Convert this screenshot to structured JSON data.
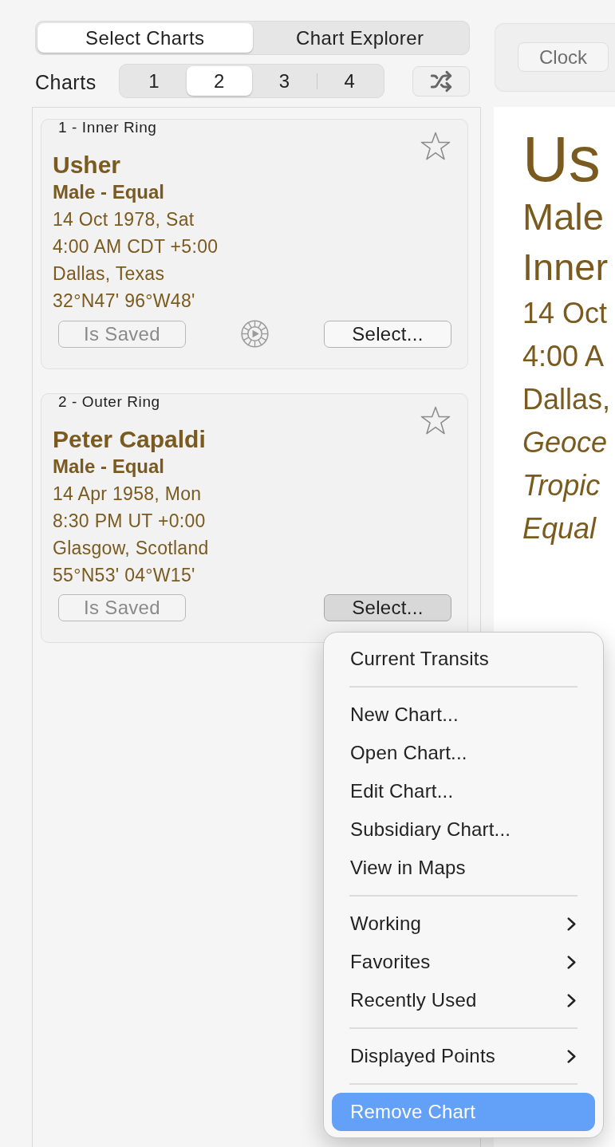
{
  "mode_tabs": [
    {
      "label": "Select Charts",
      "selected": true
    },
    {
      "label": "Chart Explorer",
      "selected": false
    }
  ],
  "charts_selector": {
    "label": "Charts",
    "options": [
      {
        "label": "1",
        "selected": false
      },
      {
        "label": "2",
        "selected": true
      },
      {
        "label": "3",
        "selected": false
      },
      {
        "label": "4",
        "selected": false
      }
    ]
  },
  "clock_panel": {
    "button": {
      "label": "Clock",
      "disabled": true
    }
  },
  "chart_cards": [
    {
      "ring_label": "1 - Inner Ring",
      "name": "Usher",
      "subtitle": "Male - Equal",
      "details": [
        "14 Oct 1978, Sat",
        "4:00 AM CDT +5:00",
        "Dallas, Texas",
        "32°N47' 96°W48'"
      ],
      "favorite": false,
      "saved_button": {
        "label": "Is Saved",
        "disabled": true
      },
      "animate_button": true,
      "select_button": {
        "label": "Select...",
        "pressed": false
      }
    },
    {
      "ring_label": "2 - Outer Ring",
      "name": "Peter Capaldi",
      "subtitle": "Male - Equal",
      "details": [
        "14 Apr 1958, Mon",
        "8:30 PM UT +0:00",
        "Glasgow, Scotland",
        "55°N53' 04°W15'"
      ],
      "favorite": false,
      "saved_button": {
        "label": "Is Saved",
        "disabled": true
      },
      "animate_button": false,
      "select_button": {
        "label": "Select...",
        "pressed": true
      }
    }
  ],
  "chart_details": {
    "lines": [
      {
        "text": "Us",
        "kind": "name"
      },
      {
        "text": "Male",
        "kind": "heading"
      },
      {
        "text": "Inner",
        "kind": "heading"
      },
      {
        "text": "14 Oct",
        "kind": "detail"
      },
      {
        "text": "4:00 A",
        "kind": "detail"
      },
      {
        "text": "Dallas,",
        "kind": "detail"
      },
      {
        "text": "Geoce",
        "kind": "italic"
      },
      {
        "text": "Tropic",
        "kind": "italic"
      },
      {
        "text": "Equal",
        "kind": "italic"
      }
    ]
  },
  "context_menu": {
    "sections": [
      {
        "items": [
          {
            "label": "Current Transits",
            "submenu": false,
            "selected": false
          }
        ]
      },
      {
        "items": [
          {
            "label": "New Chart...",
            "submenu": false,
            "selected": false
          },
          {
            "label": "Open Chart...",
            "submenu": false,
            "selected": false
          },
          {
            "label": "Edit Chart...",
            "submenu": false,
            "selected": false
          },
          {
            "label": "Subsidiary Chart...",
            "submenu": false,
            "selected": false
          },
          {
            "label": "View in Maps",
            "submenu": false,
            "selected": false
          }
        ]
      },
      {
        "items": [
          {
            "label": "Working",
            "submenu": true,
            "selected": false
          },
          {
            "label": "Favorites",
            "submenu": true,
            "selected": false
          },
          {
            "label": "Recently Used",
            "submenu": true,
            "selected": false
          }
        ]
      },
      {
        "items": [
          {
            "label": "Displayed Points",
            "submenu": true,
            "selected": false
          }
        ]
      },
      {
        "items": [
          {
            "label": "Remove Chart",
            "submenu": false,
            "selected": true
          }
        ]
      }
    ]
  }
}
